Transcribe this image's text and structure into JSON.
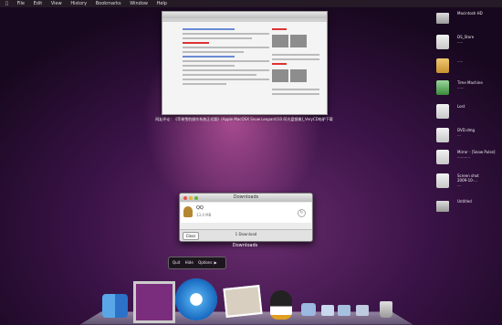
{
  "menubar": {
    "items": [
      "",
      "File",
      "Edit",
      "View",
      "History",
      "Bookmarks",
      "Window",
      "Help"
    ],
    "clock": ""
  },
  "expose": {
    "caption": "网友评论：《苹果雪豹操作系统正式版》(Apple MacOSX Snow Leopard)10.6[光盘镜像]_VeryCD电驴下载"
  },
  "desktop_icons": [
    {
      "label": "Macintosh HD"
    },
    {
      "label": "DS_Store\n....."
    },
    {
      "label": "....."
    },
    {
      "label": "Time Machine\n......"
    },
    {
      "label": "Lost"
    },
    {
      "label": "DVD.dmg\n..."
    },
    {
      "label": "Mirror - [Snow Pulse]\n..........."
    },
    {
      "label": "Screen shot\n2009-10-...\n..."
    },
    {
      "label": "Untitled"
    }
  ],
  "downloads": {
    "title": "Downloads",
    "item_name": "QQ",
    "item_size": "13.4 MB",
    "clear_label": "Clear",
    "count_label": "1 Download",
    "caption": "Downloads"
  },
  "dock_menu": {
    "quit": "Quit",
    "hide": "Hide",
    "options": "Options",
    "arrow": "▶"
  },
  "colors": {
    "wallpaper_base": "#3a1347",
    "wallpaper_glow": "#ff78c8",
    "traffic_red": "#e2544b",
    "traffic_yellow": "#e3b534",
    "traffic_green": "#5fb540"
  }
}
